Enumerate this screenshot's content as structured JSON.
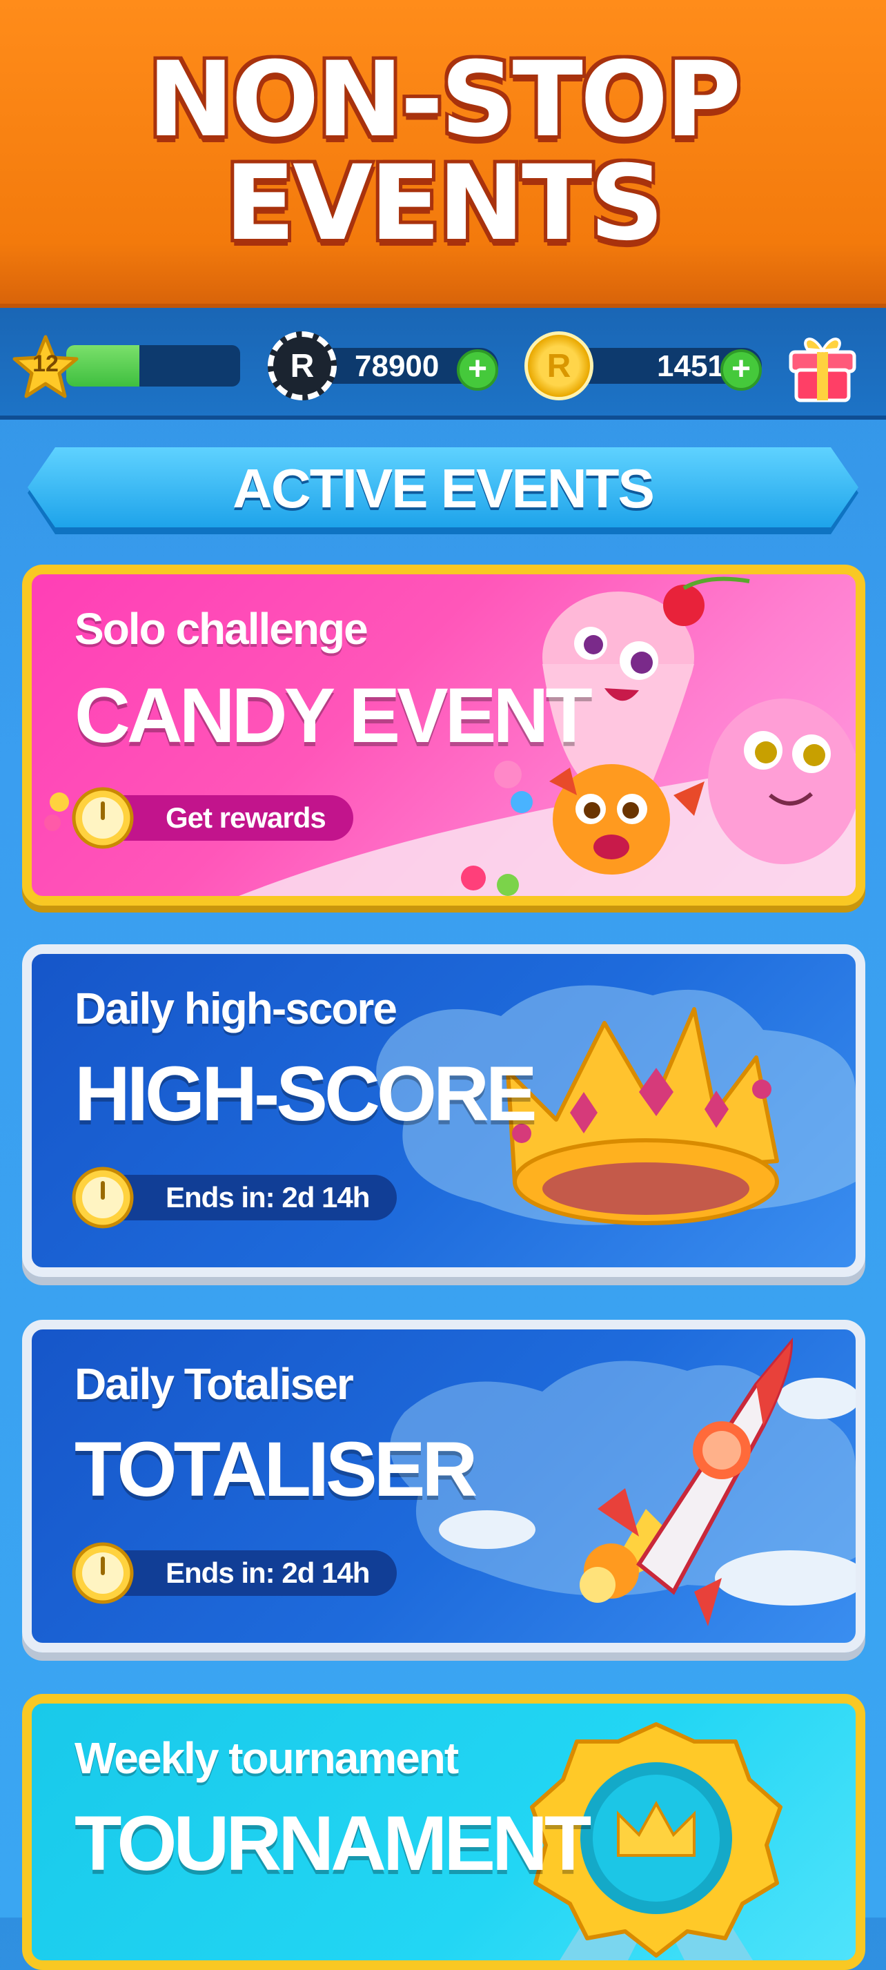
{
  "banner": {
    "line1": "NON-STOP",
    "line2": "EVENTS"
  },
  "stats": {
    "level": "12",
    "xp_progress": 0.42,
    "chips_value": "78900",
    "chips_icon_letter": "R",
    "coins_value": "1451",
    "coins_icon_letter": "R",
    "plus_symbol": "+",
    "icons": [
      "star-level-icon",
      "chip-icon",
      "coin-icon",
      "plus-icon",
      "gift-icon"
    ]
  },
  "section": {
    "header": "ACTIVE EVENTS"
  },
  "events": [
    {
      "subtitle": "Solo challenge",
      "title": "CANDY EVENT",
      "status": "Get rewards",
      "accent": "#ff3fb6"
    },
    {
      "subtitle": "Daily high-score",
      "title": "HIGH-SCORE",
      "status": "Ends in: 2d 14h",
      "accent": "#1e6bdc"
    },
    {
      "subtitle": "Daily Totaliser",
      "title": "TOTALISER",
      "status": "Ends in: 2d 14h",
      "accent": "#1e6bdc"
    },
    {
      "subtitle": "Weekly tournament",
      "title": "TOURNAMENT",
      "status": "",
      "accent": "#22d6f4"
    }
  ],
  "colors": {
    "banner_orange": "#f37a0c",
    "gold_border": "#f9c823",
    "plus_green": "#45c93b"
  }
}
